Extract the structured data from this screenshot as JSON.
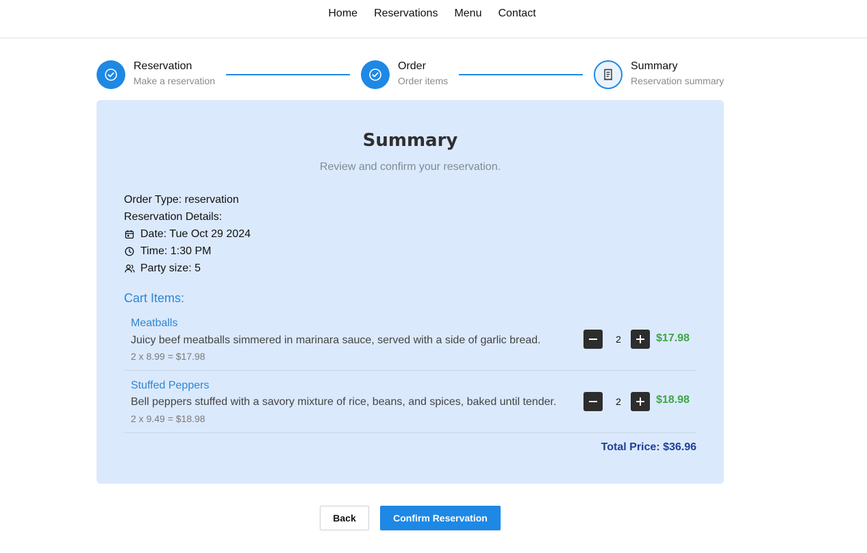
{
  "nav": {
    "links": [
      "Home",
      "Reservations",
      "Menu",
      "Contact"
    ]
  },
  "stepper": {
    "steps": [
      {
        "title": "Reservation",
        "subtitle": "Make a reservation",
        "status": "complete",
        "icon": "check-circle-icon"
      },
      {
        "title": "Order",
        "subtitle": "Order items",
        "status": "complete",
        "icon": "check-circle-icon"
      },
      {
        "title": "Summary",
        "subtitle": "Reservation summary",
        "status": "current",
        "icon": "receipt-icon"
      }
    ],
    "accent_color": "#1e88e5"
  },
  "summary": {
    "heading": "Summary",
    "subheading": "Review and confirm your reservation.",
    "order_type": "Order Type: reservation",
    "details_label": "Reservation Details:",
    "date": "Date: Tue Oct 29 2024",
    "time": "Time: 1:30 PM",
    "party_size": "Party size: 5"
  },
  "cart": {
    "title": "Cart Items:",
    "items": [
      {
        "name": "Meatballs",
        "description": "Juicy beef meatballs simmered in marinara sauce, served with a side of garlic bread.",
        "calc": "2 x 8.99 = $17.98",
        "quantity": "2",
        "price": "$17.98"
      },
      {
        "name": "Stuffed Peppers",
        "description": "Bell peppers stuffed with a savory mixture of rice, beans, and spices, baked until tender.",
        "calc": "2 x 9.49 = $18.98",
        "quantity": "2",
        "price": "$18.98"
      }
    ],
    "total": "Total Price: $36.96"
  },
  "actions": {
    "back_label": "Back",
    "confirm_label": "Confirm Reservation"
  },
  "colors": {
    "card_bg": "#dbe9fc",
    "link_blue": "#2c86d3",
    "price_green": "#3aa845",
    "total_navy": "#1e3f95"
  }
}
